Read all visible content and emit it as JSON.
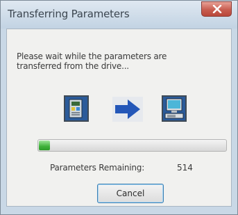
{
  "window": {
    "title": "Transferring Parameters"
  },
  "message": "Please wait while the parameters are transferred from the drive...",
  "progress": {
    "fraction": 0.06,
    "remaining_label": "Parameters Remaining:",
    "remaining_value": "514"
  },
  "buttons": {
    "cancel_label": "Cancel"
  },
  "icons": {
    "drive": "drive-icon",
    "arrow": "arrow-right-icon",
    "computer": "computer-icon",
    "close": "close-icon"
  },
  "colors": {
    "progress_fill": "#3fb13a",
    "arrow": "#2457b8",
    "close_button": "#c85d4f"
  }
}
